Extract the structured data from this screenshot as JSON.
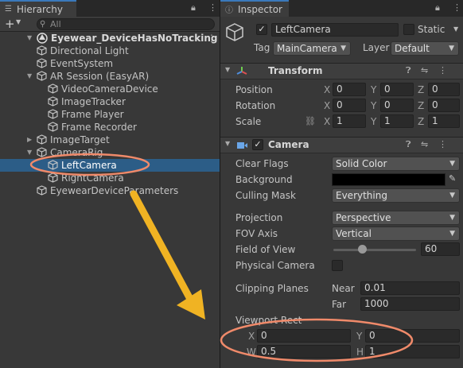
{
  "hierarchy": {
    "tab_label": "Hierarchy",
    "add_label": "+",
    "search_placeholder": "All",
    "scene_name": "Eyewear_DeviceHasNoTracking",
    "items": [
      {
        "label": "Directional Light",
        "depth": 1,
        "expandable": false
      },
      {
        "label": "EventSystem",
        "depth": 1,
        "expandable": false
      },
      {
        "label": "AR Session (EasyAR)",
        "depth": 1,
        "expandable": true
      },
      {
        "label": "VideoCameraDevice",
        "depth": 2,
        "expandable": false
      },
      {
        "label": "ImageTracker",
        "depth": 2,
        "expandable": false
      },
      {
        "label": "Frame Player",
        "depth": 2,
        "expandable": false
      },
      {
        "label": "Frame Recorder",
        "depth": 2,
        "expandable": false
      },
      {
        "label": "ImageTarget",
        "depth": 1,
        "expandable": true
      },
      {
        "label": "CameraRig",
        "depth": 1,
        "expandable": true
      },
      {
        "label": "LeftCamera",
        "depth": 2,
        "expandable": false,
        "selected": true
      },
      {
        "label": "RightCamera",
        "depth": 2,
        "expandable": false
      },
      {
        "label": "EyewearDeviceParameters",
        "depth": 1,
        "expandable": false
      }
    ]
  },
  "inspector": {
    "tab_label": "Inspector",
    "object_name": "LeftCamera",
    "static_label": "Static",
    "tag_label": "Tag",
    "tag_value": "MainCamera",
    "layer_label": "Layer",
    "layer_value": "Default",
    "transform": {
      "title": "Transform",
      "position_label": "Position",
      "rotation_label": "Rotation",
      "scale_label": "Scale",
      "position": {
        "x": "0",
        "y": "0",
        "z": "0"
      },
      "rotation": {
        "x": "0",
        "y": "0",
        "z": "0"
      },
      "scale": {
        "x": "1",
        "y": "1",
        "z": "1"
      }
    },
    "camera": {
      "title": "Camera",
      "clear_flags_label": "Clear Flags",
      "clear_flags_value": "Solid Color",
      "background_label": "Background",
      "background_color": "#000000",
      "culling_mask_label": "Culling Mask",
      "culling_mask_value": "Everything",
      "projection_label": "Projection",
      "projection_value": "Perspective",
      "fov_axis_label": "FOV Axis",
      "fov_axis_value": "Vertical",
      "fov_label": "Field of View",
      "fov_value": "60",
      "physical_camera_label": "Physical Camera",
      "clipping_label": "Clipping Planes",
      "near_label": "Near",
      "near_value": "0.01",
      "far_label": "Far",
      "far_value": "1000",
      "viewport_label": "Viewport Rect",
      "viewport": {
        "x": "0",
        "y": "0",
        "w": "0.5",
        "h": "1"
      }
    }
  },
  "axis_labels": {
    "x": "X",
    "y": "Y",
    "z": "Z",
    "w": "W",
    "h": "H"
  },
  "colors": {
    "annotation": "#f08a6a",
    "arrow": "#f0b323",
    "selection": "#2c5d87"
  }
}
